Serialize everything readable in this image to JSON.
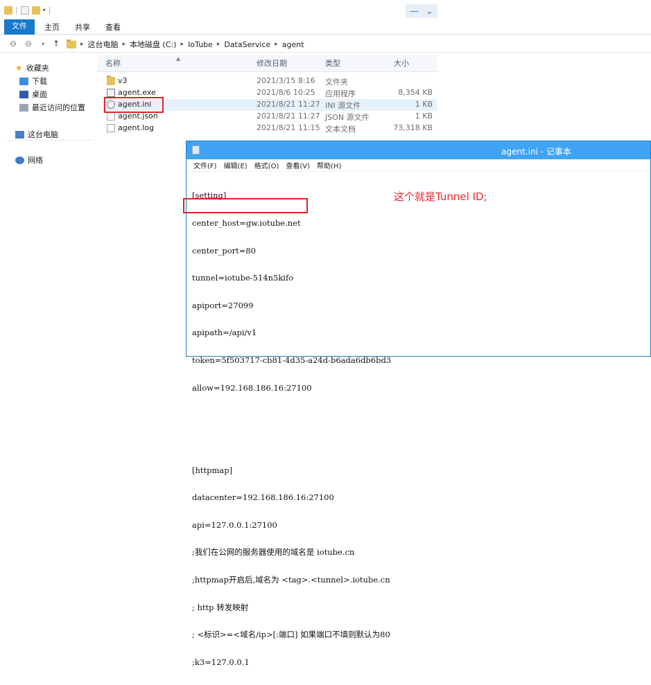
{
  "explorer": {
    "ribbon_tabs": [
      "文件",
      "主页",
      "共享",
      "查看"
    ],
    "breadcrumbs": [
      "这台电脑",
      "本地磁盘 (C:)",
      "IoTube",
      "DataService",
      "agent"
    ],
    "sidebar": {
      "favorites": "收藏夹",
      "downloads": "下载",
      "desktop": "桌面",
      "recent": "最近访问的位置",
      "this_pc": "这台电脑",
      "network": "网络"
    },
    "columns": {
      "name": "名称",
      "modified": "修改日期",
      "type": "类型",
      "size": "大小"
    },
    "files": [
      {
        "name": "v3",
        "modified": "2021/3/15 8:16",
        "type": "文件夹",
        "size": ""
      },
      {
        "name": "agent.exe",
        "modified": "2021/8/6 10:25",
        "type": "应用程序",
        "size": "8,354 KB"
      },
      {
        "name": "agent.ini",
        "modified": "2021/8/21 11:27",
        "type": "INI 源文件",
        "size": "1 KB"
      },
      {
        "name": "agent.json",
        "modified": "2021/8/21 11:27",
        "type": "JSON 源文件",
        "size": "1 KB"
      },
      {
        "name": "agent.log",
        "modified": "2021/8/21 11:15",
        "type": "文本文档",
        "size": "73,318 KB"
      }
    ]
  },
  "notepad": {
    "title": "agent.ini - 记事本",
    "menu": [
      "文件(F)",
      "编辑(E)",
      "格式(O)",
      "查看(V)",
      "帮助(H)"
    ],
    "lines": [
      "[setting]",
      "center_host=gw.iotube.net",
      "center_port=80",
      "tunnel=iotube-514n5kifo",
      "apiport=27099",
      "apipath=/api/v1",
      "token=5f503717-cb81-4d35-a24d-b6ada6db6bd3",
      "allow=192.168.186.16:27100",
      "",
      "",
      "[httpmap]",
      "datacenter=192.168.186.16:27100",
      "api=127.0.0.1:27100",
      ";我们在公网的服务器使用的域名是 iotube.cn",
      ";httpmap开启后,域名为 <tag>.<tunnel>.iotube.cn",
      "; http 转发映射",
      "; <标识>=<域名/ip>[:端口] 如果端口不填则默认为80",
      ";k3=127.0.0.1"
    ]
  },
  "annotation": "这个就是Tunnel ID;",
  "colors": {
    "accent": "#1979ca",
    "highlight": "#e02424",
    "notepad_title": "#41a3f3"
  }
}
